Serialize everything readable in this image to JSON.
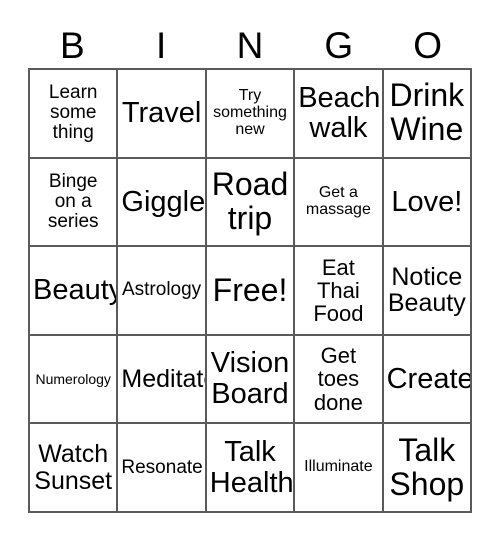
{
  "card": {
    "title": "BINGO",
    "columns": [
      "B",
      "I",
      "N",
      "G",
      "O"
    ],
    "free_space_label": "Free!",
    "border_color": "#5a5a5a",
    "text_color": "#000000",
    "background_color": "#ffffff"
  },
  "cells": [
    [
      {
        "text": "Learn\nsome\nthing",
        "size": "m"
      },
      {
        "text": "Travel",
        "size": "xxl"
      },
      {
        "text": "Try\nsomething\nnew",
        "size": "s"
      },
      {
        "text": "Beach\nwalk",
        "size": "xxl"
      },
      {
        "text": "Drink\nWine",
        "size": "xxxl"
      }
    ],
    [
      {
        "text": "Binge\non a\nseries",
        "size": "m"
      },
      {
        "text": "Giggle",
        "size": "xxl"
      },
      {
        "text": "Road\ntrip",
        "size": "xxxl"
      },
      {
        "text": "Get a\nmassage",
        "size": "s"
      },
      {
        "text": "Love!",
        "size": "xxl"
      }
    ],
    [
      {
        "text": "Beauty",
        "size": "xxl"
      },
      {
        "text": "Astrology",
        "size": "m"
      },
      {
        "text": "Free!",
        "size": "xxxl"
      },
      {
        "text": "Eat\nThai\nFood",
        "size": "l"
      },
      {
        "text": "Notice\nBeauty",
        "size": "xl"
      }
    ],
    [
      {
        "text": "Numerology",
        "size": "xs"
      },
      {
        "text": "Meditate",
        "size": "xl"
      },
      {
        "text": "Vision\nBoard",
        "size": "xxl"
      },
      {
        "text": "Get\ntoes\ndone",
        "size": "l"
      },
      {
        "text": "Create",
        "size": "xxl"
      }
    ],
    [
      {
        "text": "Watch\nSunset",
        "size": "xl"
      },
      {
        "text": "Resonate",
        "size": "m"
      },
      {
        "text": "Talk\nHealth",
        "size": "xxl"
      },
      {
        "text": "Illuminate",
        "size": "s"
      },
      {
        "text": "Talk\nShop",
        "size": "xxxl"
      }
    ]
  ]
}
